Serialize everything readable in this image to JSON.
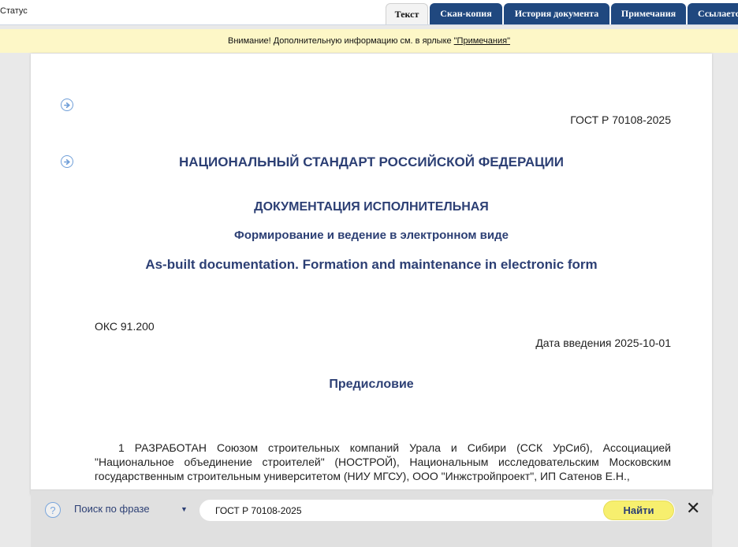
{
  "status_label": "Статус",
  "tabs": [
    {
      "label": "Текст",
      "active": true
    },
    {
      "label": "Скан-копия",
      "active": false
    },
    {
      "label": "История документа",
      "active": false
    },
    {
      "label": "Примечания",
      "active": false
    },
    {
      "label": "Ссылается",
      "active": false
    }
  ],
  "notice": {
    "text": "Внимание! Дополнительную информацию см. в ярлыке",
    "link": "\"Примечания\""
  },
  "document": {
    "code": "ГОСТ Р 70108-2025",
    "heading": "НАЦИОНАЛЬНЫЙ СТАНДАРТ РОССИЙСКОЙ ФЕДЕРАЦИИ",
    "title": "ДОКУМЕНТАЦИЯ ИСПОЛНИТЕЛЬНАЯ",
    "subtitle": "Формирование и ведение в электронном виде",
    "english_title": "As-built documentation. Formation and maintenance in electronic form",
    "okc": "ОКС 91.200",
    "date": "Дата введения 2025-10-01",
    "section_title": "Предисловие",
    "paragraph": "1 РАЗРАБОТАН Союзом строительных компаний Урала и Сибири (ССК УрСиб), Ассоциацией \"Национальное объединение строителей\" (НОСТРОЙ), Национальным исследовательским Московским государственным строительным университетом (НИУ МГСУ), ООО \"Инжстройпроект\", ИП Сатенов Е.Н.,"
  },
  "search": {
    "help_symbol": "?",
    "mode": "Поиск по фразе",
    "query": "ГОСТ Р 70108-2025",
    "find_label": "Найти",
    "close_symbol": "✕"
  },
  "colors": {
    "tab_inactive": "#20487f",
    "notice_bg": "#fdf7c7",
    "heading": "#2c3f74",
    "find_button": "#f7ef6e"
  }
}
